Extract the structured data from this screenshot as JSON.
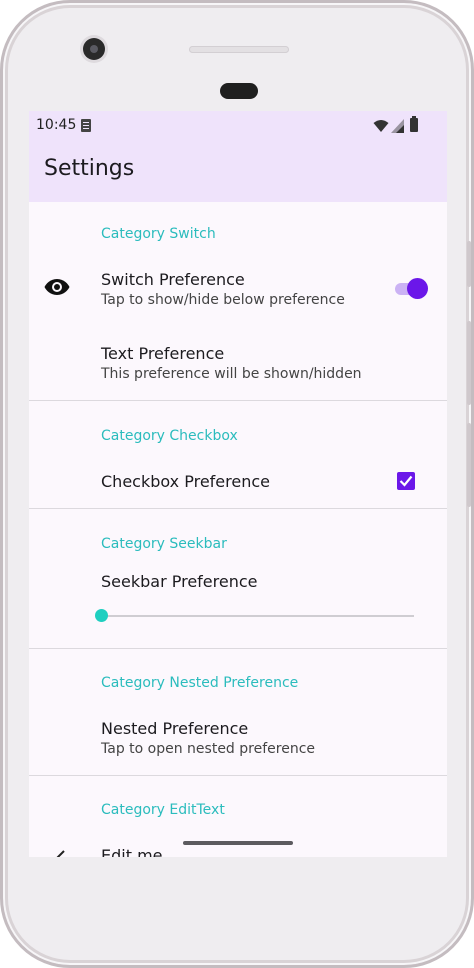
{
  "status_bar": {
    "time": "10:45"
  },
  "app_bar": {
    "title": "Settings"
  },
  "categories": {
    "switch": {
      "label": "Category Switch",
      "switch_pref": {
        "title": "Switch Preference",
        "summary": "Tap to show/hide below preference",
        "checked": true,
        "icon": "eye-icon"
      },
      "text_pref": {
        "title": "Text Preference",
        "summary": "This preference will be shown/hidden"
      }
    },
    "checkbox": {
      "label": "Category Checkbox",
      "checkbox_pref": {
        "title": "Checkbox Preference",
        "checked": true
      }
    },
    "seekbar": {
      "label": "Category Seekbar",
      "seekbar_pref": {
        "title": "Seekbar Preference",
        "value_fraction": 0.0
      }
    },
    "nested": {
      "label": "Category Nested Preference",
      "nested_pref": {
        "title": "Nested Preference",
        "summary": "Tap to open nested preference"
      }
    },
    "edittext": {
      "label": "Category EditText",
      "edit_pref": {
        "title": "Edit me"
      }
    }
  },
  "colors": {
    "accent": "#6b17e9",
    "category": "#2bbcbd",
    "app_bar": "#efe3fb",
    "seek_thumb": "#1fcfc0"
  }
}
